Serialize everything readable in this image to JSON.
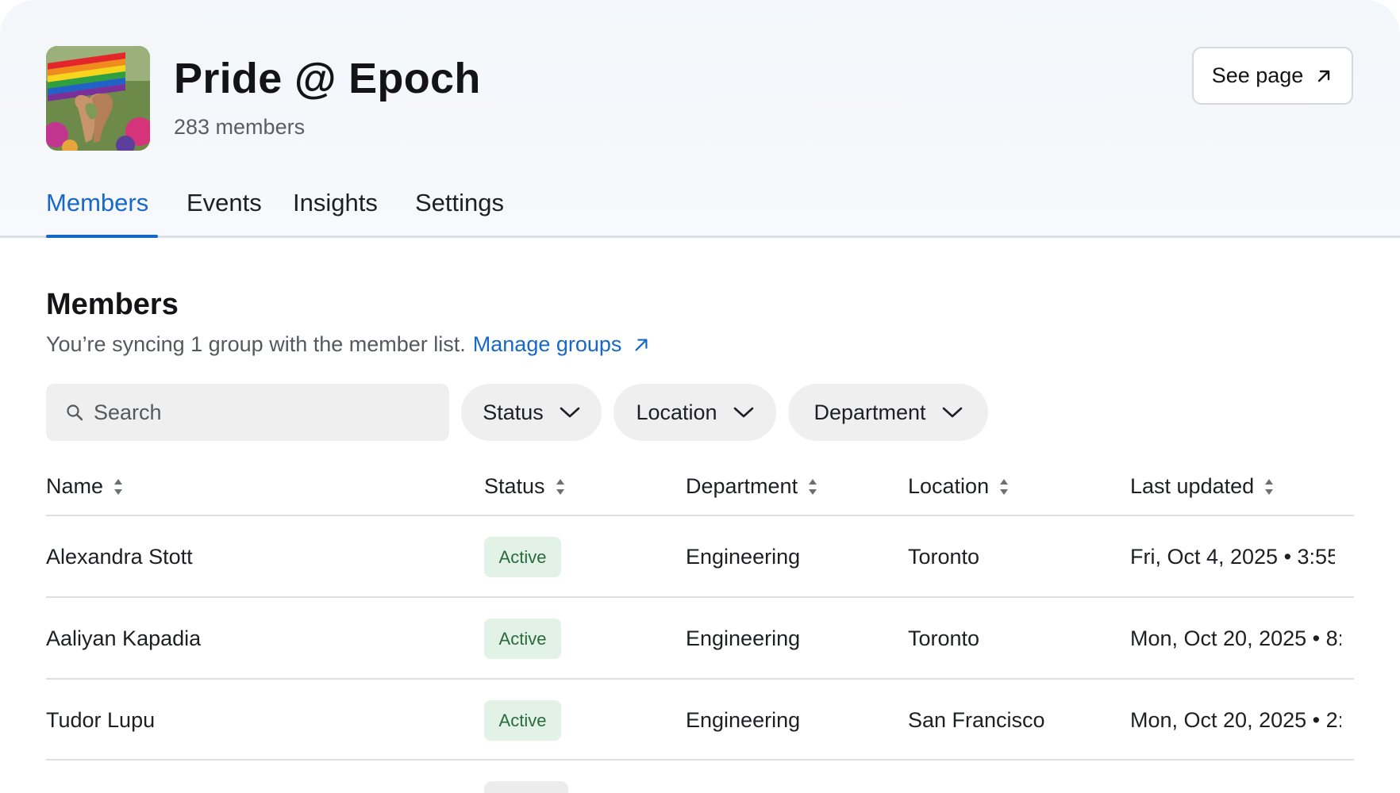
{
  "group": {
    "name": "Pride @ Epoch",
    "member_count": "283 members",
    "see_page_label": "See page",
    "avatar_icon": "pride-flag-heart-hands-photo"
  },
  "tabs": [
    {
      "label": "Members",
      "active": true
    },
    {
      "label": "Events",
      "active": false
    },
    {
      "label": "Insights",
      "active": false
    },
    {
      "label": "Settings",
      "active": false
    }
  ],
  "members_section": {
    "title": "Members",
    "sync_text": "You’re syncing 1 group with the member list.",
    "manage_link": "Manage groups"
  },
  "filters": {
    "search_placeholder": "Search",
    "status_label": "Status",
    "location_label": "Location",
    "department_label": "Department"
  },
  "table": {
    "columns": [
      "Name",
      "Status",
      "Department",
      "Location",
      "Last updated"
    ],
    "rows": [
      {
        "name": "Alexandra Stott",
        "status": "Active",
        "department": "Engineering",
        "location": "Toronto",
        "last_updated": "Fri, Oct 4, 2025 • 3:55"
      },
      {
        "name": "Aaliyan Kapadia",
        "status": "Active",
        "department": "Engineering",
        "location": "Toronto",
        "last_updated": "Mon, Oct 20, 2025 • 8:"
      },
      {
        "name": "Tudor Lupu",
        "status": "Active",
        "department": "Engineering",
        "location": "San Francisco",
        "last_updated": "Mon, Oct 20, 2025 • 2:"
      }
    ]
  },
  "colors": {
    "accent": "#1768c9",
    "active_badge_bg": "#e3f2e7",
    "active_badge_text": "#2a6a3c",
    "divider": "#dcdfe3"
  }
}
